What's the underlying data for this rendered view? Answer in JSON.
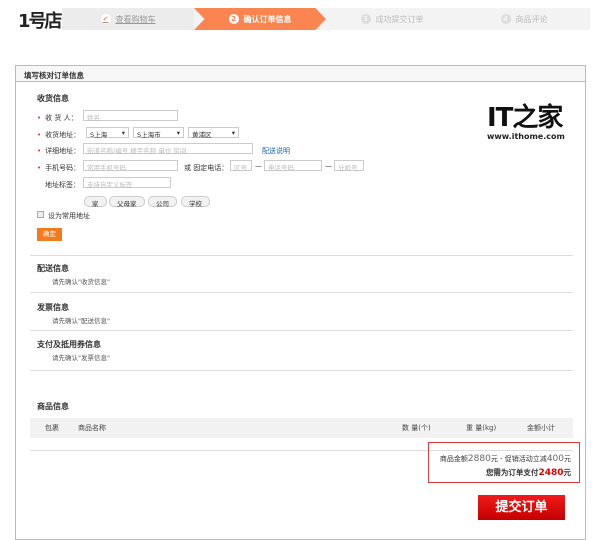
{
  "logo": {
    "text": "1号店"
  },
  "steps": [
    {
      "num": "✔",
      "label": "查看购物车"
    },
    {
      "num": "2",
      "label": "确认订单信息"
    },
    {
      "num": "3",
      "label": "成功提交订单"
    },
    {
      "num": "4",
      "label": "商品评论"
    }
  ],
  "panel_title": "填写核对订单信息",
  "receiver": {
    "title": "收货信息",
    "name_label": "收 货 人：",
    "name_placeholder": "姓名",
    "address_label": "收货地址：",
    "province": "S上海",
    "city": "S上海市",
    "district": "黄浦区",
    "detail_label": "详细地址：",
    "detail_placeholder": "街道名称/编号 楼宇名称 单位 房间",
    "delivery_link": "配送说明",
    "mobile_label": "手机号码：",
    "mobile_placeholder": "常用手机号码",
    "phone_label": "或 固定电话：",
    "area_placeholder": "区号",
    "phone_placeholder": "电话号码",
    "ext_placeholder": "分机号",
    "dash": "—",
    "tag_label": "地址标签：",
    "tag_placeholder": "支持自定义标签",
    "tags": [
      "家",
      "父母家",
      "公司",
      "学校"
    ],
    "default_label": "设为常用地址",
    "confirm": "确定"
  },
  "watermark": {
    "logo": "IT之家",
    "url": "www.ithome.com"
  },
  "sections": [
    {
      "title": "配送信息",
      "note": "请先确认\"收货信息\""
    },
    {
      "title": "发票信息",
      "note": "请先确认\"配送信息\""
    },
    {
      "title": "支付及抵用券信息",
      "note": "请先确认\"发票信息\""
    }
  ],
  "goods": {
    "title": "商品信息",
    "columns": [
      "包裹",
      "商品名称",
      "数 量(个)",
      "重 量(kg)",
      "金额小计"
    ]
  },
  "total": {
    "prefix": "商品金额",
    "amount": "2880",
    "unit": "元",
    "promo": " - 促销活动立减",
    "discount": "400",
    "pay_label": "您需为订单支付",
    "pay_amount": "2480"
  },
  "submit": "提交订单"
}
